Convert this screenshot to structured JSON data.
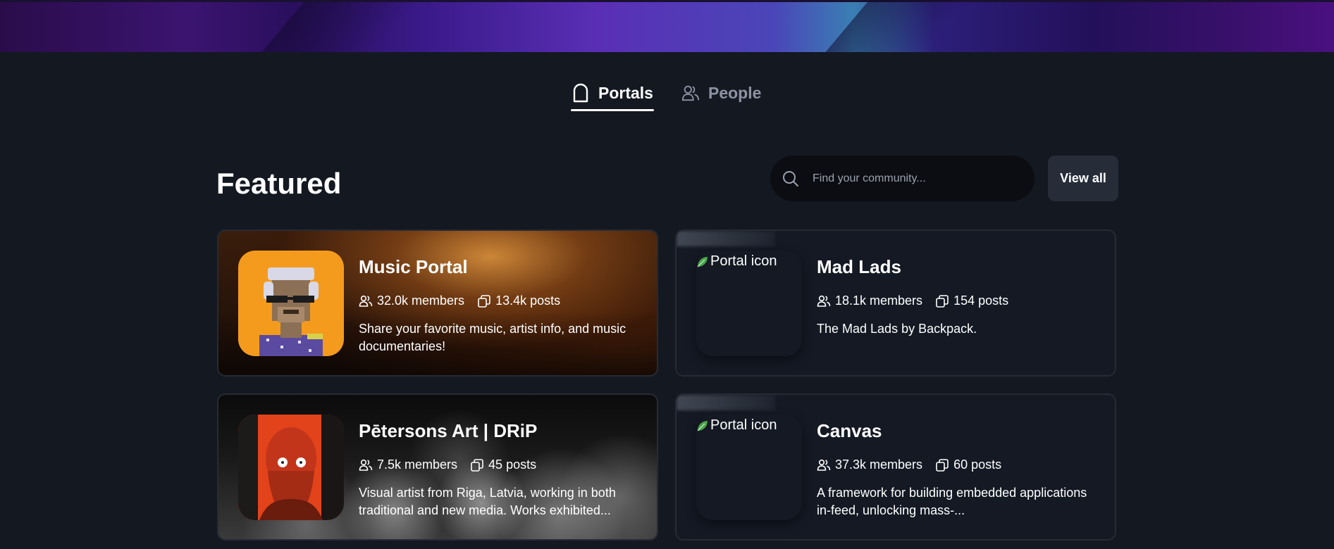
{
  "tabs": [
    {
      "label": "Portals",
      "icon": "portal-icon",
      "active": true
    },
    {
      "label": "People",
      "icon": "people-icon",
      "active": false
    }
  ],
  "featured": {
    "title": "Featured",
    "search_placeholder": "Find your community...",
    "view_all_label": "View all"
  },
  "cards": [
    {
      "title": "Music Portal",
      "members": "32.0k members",
      "posts": "13.4k posts",
      "description": "Share your favorite music, artist info, and music documentaries!"
    },
    {
      "title": "Mad Lads",
      "members": "18.1k members",
      "posts": "154 posts",
      "description": "The Mad Lads by Backpack.",
      "icon_alt": "Portal icon"
    },
    {
      "title": "Pētersons Art | DRiP",
      "members": "7.5k members",
      "posts": "45 posts",
      "description": "Visual artist from Riga, Latvia, working in both traditional and new media. Works exhibited..."
    },
    {
      "title": "Canvas",
      "members": "37.3k members",
      "posts": "60 posts",
      "description": "A framework for building embedded applications in-feed, unlocking mass-...",
      "icon_alt": "Portal icon"
    }
  ]
}
